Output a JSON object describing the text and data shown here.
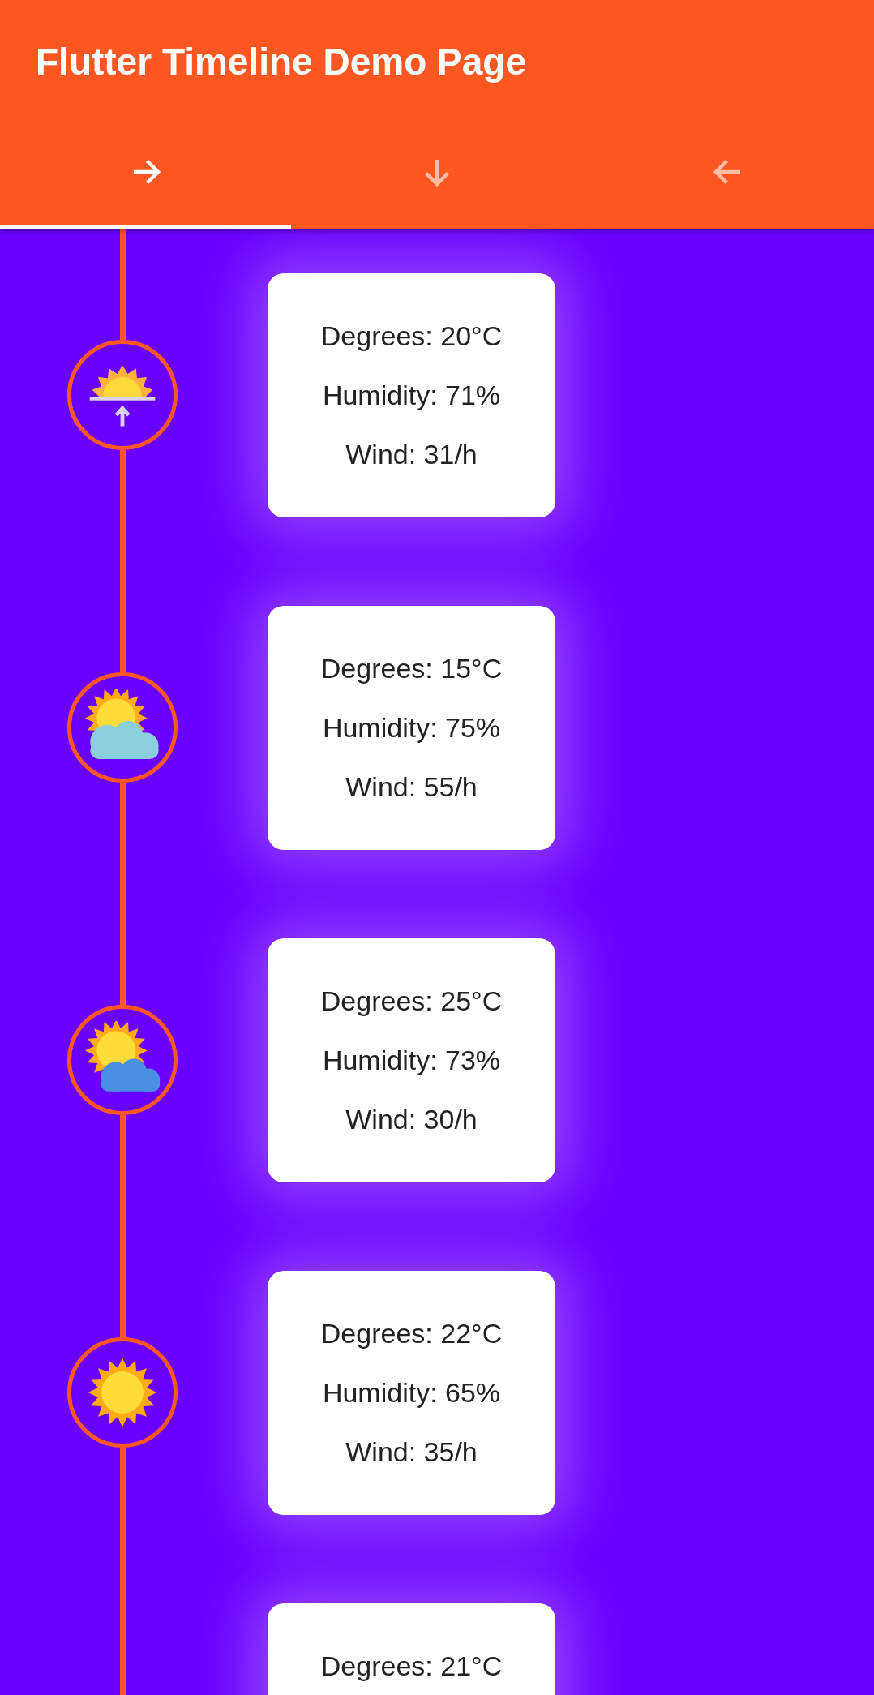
{
  "app_bar": {
    "title": "Flutter Timeline Demo Page"
  },
  "tabs": [
    {
      "kind": "right",
      "selected": true
    },
    {
      "kind": "down",
      "selected": false
    },
    {
      "kind": "left",
      "selected": false
    }
  ],
  "timeline": [
    {
      "kind": "sunrise",
      "lines": [
        "Degrees: 20°C",
        "Humidity: 71%",
        "Wind: 31/h"
      ]
    },
    {
      "kind": "sun-cloud",
      "lines": [
        "Degrees: 15°C",
        "Humidity: 75%",
        "Wind: 55/h"
      ]
    },
    {
      "kind": "sun-blue-cloud",
      "lines": [
        "Degrees: 25°C",
        "Humidity: 73%",
        "Wind: 30/h"
      ]
    },
    {
      "kind": "sun",
      "lines": [
        "Degrees: 22°C",
        "Humidity: 65%",
        "Wind: 35/h"
      ]
    },
    {
      "lines": [
        "Degrees: 21°C"
      ]
    }
  ]
}
